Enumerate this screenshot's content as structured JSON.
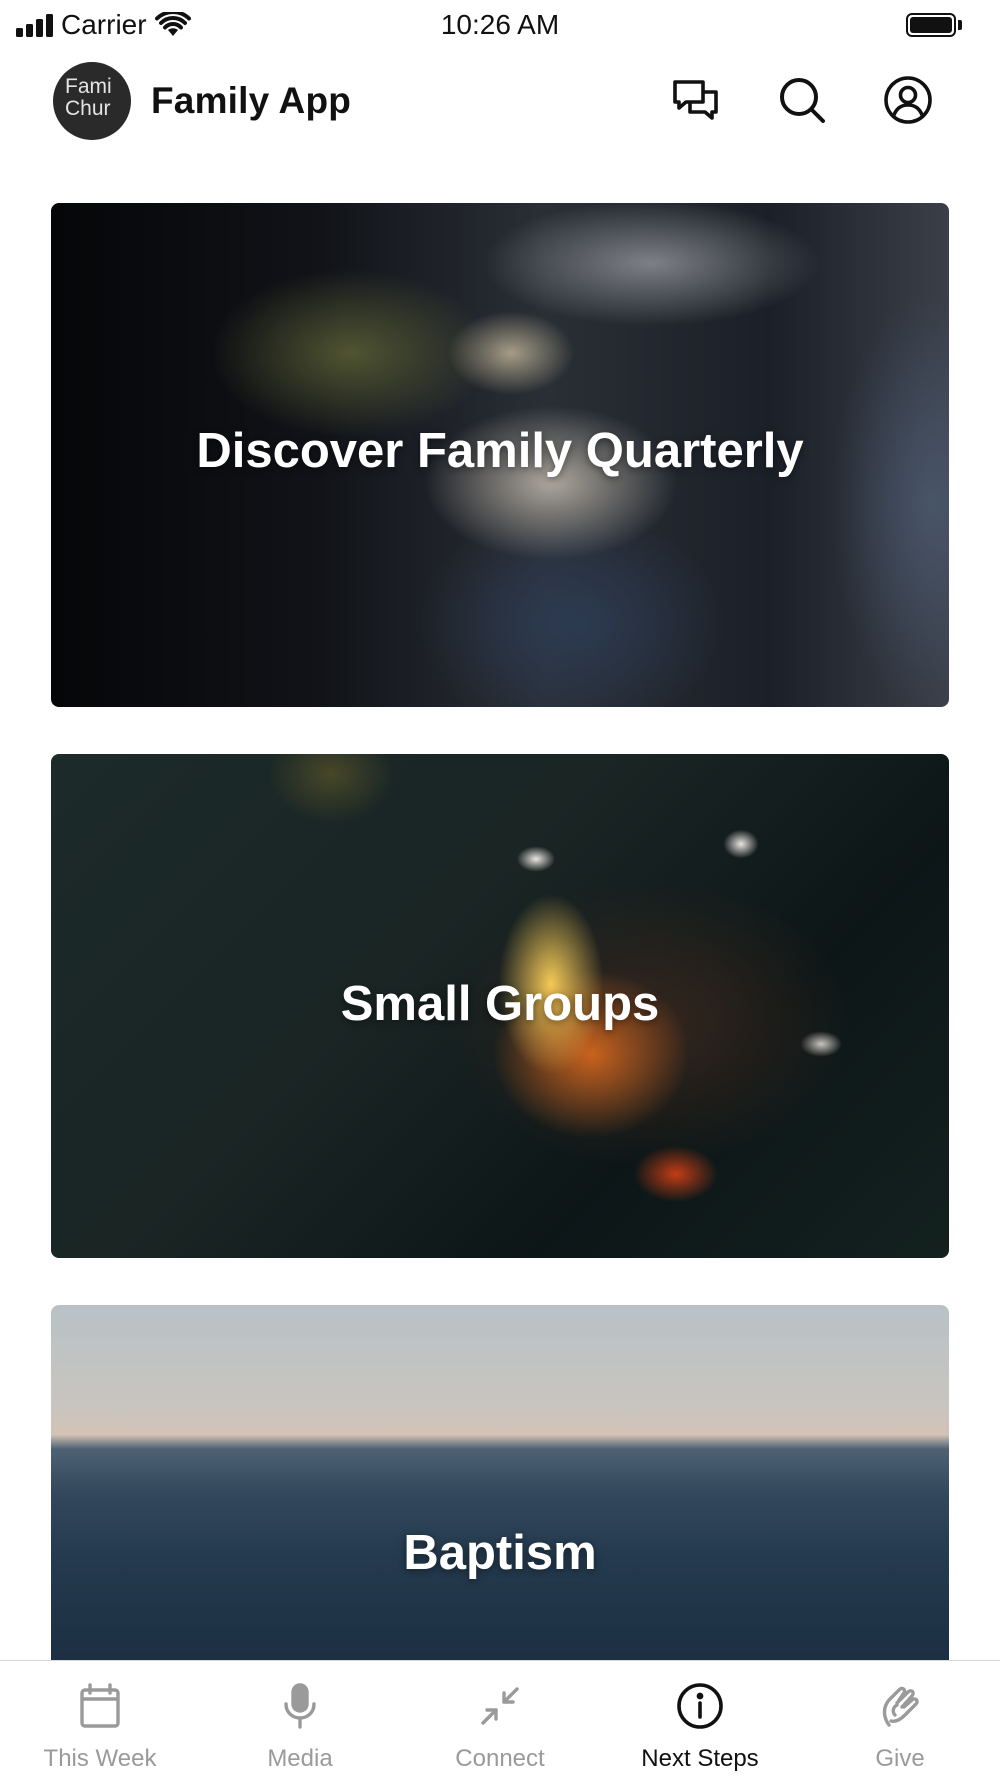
{
  "status_bar": {
    "carrier": "Carrier",
    "time": "10:26 AM",
    "battery_level": 1.0
  },
  "header": {
    "logo_text": "Fami\nChur",
    "title": "Family App",
    "icons": [
      "chat-icon",
      "search-icon",
      "profile-icon"
    ]
  },
  "cards": [
    {
      "title": "Discover Family Quarterly"
    },
    {
      "title": "Small Groups"
    },
    {
      "title": "Baptism"
    }
  ],
  "tab_bar": {
    "tabs": [
      {
        "label": "This Week",
        "icon": "calendar-icon",
        "active": false
      },
      {
        "label": "Media",
        "icon": "microphone-icon",
        "active": false
      },
      {
        "label": "Connect",
        "icon": "connect-arrows-icon",
        "active": false
      },
      {
        "label": "Next Steps",
        "icon": "info-icon",
        "active": true
      },
      {
        "label": "Give",
        "icon": "give-icon",
        "active": false
      }
    ],
    "active_color": "#111111",
    "inactive_color": "#9a9a9a"
  }
}
